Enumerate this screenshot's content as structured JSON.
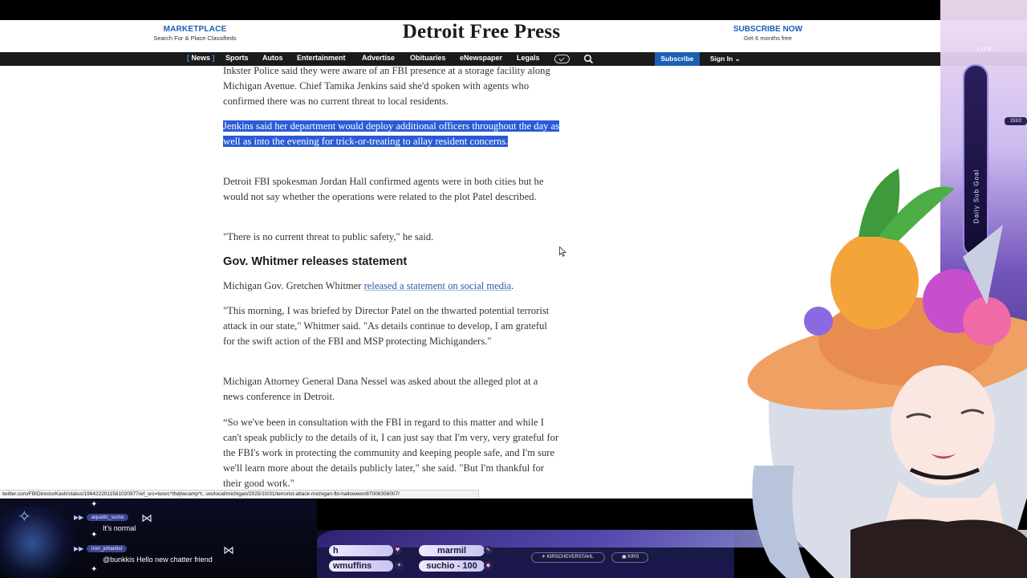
{
  "masthead": {
    "marketplace_title": "MARKETPLACE",
    "marketplace_sub": "Search For & Place Classifieds",
    "logo": "Detroit Free Press",
    "subscribe_title": "SUBSCRIBE NOW",
    "subscribe_sub": "Get 6 months free"
  },
  "nav": {
    "items": [
      "News",
      "Sports",
      "Autos",
      "Entertainment",
      "Advertise",
      "Obituaries",
      "eNewspaper",
      "Legals"
    ],
    "subscribe": "Subscribe",
    "signin": "Sign In"
  },
  "article": {
    "p1": "Inkster Police said they were aware of an FBI presence at a storage facility along Michigan Avenue. Chief Tamika Jenkins said she'd spoken with agents who confirmed there was no current threat to local residents.",
    "p2_selected": "Jenkins said her department would deploy additional officers throughout the day as well as into the evening for trick-or-treating to allay resident concerns.",
    "p3": "Detroit FBI spokesman Jordan Hall confirmed agents were in both cities but he would not say whether the operations were related to the plot Patel described.",
    "p4": "\"There is no current threat to public safety,\" he said.",
    "heading": "Gov. Whitmer releases statement",
    "p5_prefix": "Michigan Gov. Gretchen Whitmer ",
    "p5_link": "released a statement on social media",
    "p5_suffix": ".",
    "p6": "\"This morning, I was briefed by Director Patel on the thwarted potential terrorist attack in our state,\" Whitmer said. \"As details continue to develop, I am grateful for the swift action of the FBI and MSP protecting Michiganders.\"",
    "p7": "Michigan Attorney General Dana Nessel was asked about the alleged plot at a news conference in Detroit.",
    "p8": "“So we've been in consultation with the FBI in regard to this matter and while I can't speak publicly to the details of it, I can just say that I'm very, very grateful for the FBI's work in protecting the community and keeping people safe, and I'm sure we'll learn more about the details publicly later,\" she said. \"But I'm thankful for their good work.\""
  },
  "statusbar": {
    "url": "twitter.com/FBIDirectorKash/status/1984222011581020977ref_src=twsrc^tfw|twcamp^t...ws/local/michigan/2025/10/31/terrorist-attack-michigan-fbi-halloween/87006356007/"
  },
  "chat": {
    "messages": [
      {
        "user": "aquatic_sumo",
        "text": "It's normal"
      },
      {
        "user": "iron_johanlist",
        "text": "@bunkkis Hello new chatter friend"
      }
    ]
  },
  "ticker": {
    "pills": [
      "h",
      "marmil",
      "wmuffins",
      "suchio - 100"
    ],
    "social1": "KIRSCHEVERSTAHL",
    "social2": "KIRS"
  },
  "stream": {
    "live": "LIVE!",
    "count": "153/2",
    "subgoal": "Daily Sub Goal"
  },
  "colors": {
    "accent": "#1a5fb4",
    "selection": "#2a5bd6",
    "nav_bg": "#1b1b1b"
  }
}
